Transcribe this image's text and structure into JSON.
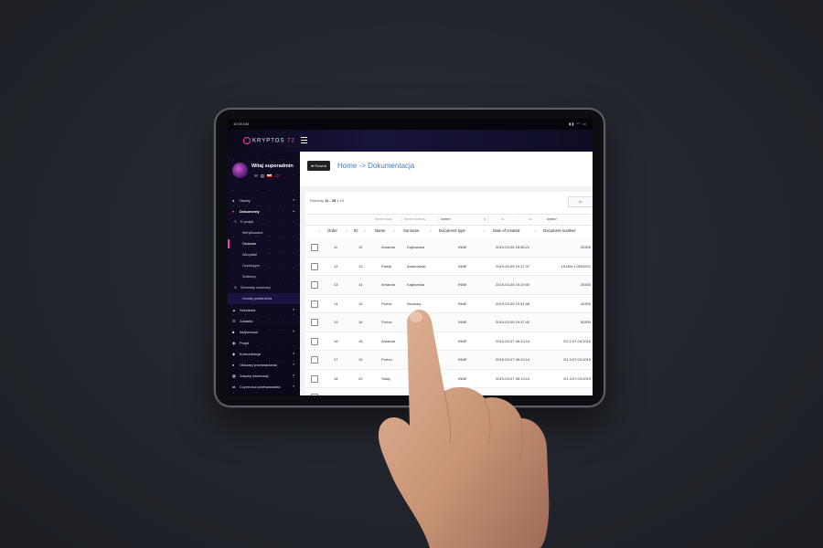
{
  "status_bar": {
    "time": "10:05 AM"
  },
  "app": {
    "logo_text": "KRYPTOS",
    "logo_version": "72"
  },
  "profile": {
    "welcome": "Witaj superadmin"
  },
  "sidebar": {
    "items": [
      {
        "label": "Osoby",
        "icon": "person-icon"
      },
      {
        "label": "Dokumenty",
        "icon": "document-icon",
        "active": true
      },
      {
        "label": "E-podpis",
        "icon": "pen-icon",
        "sub": true
      },
      {
        "label": "Weryfikowane",
        "sub": true
      },
      {
        "label": "Osobowe",
        "sub": true,
        "selected": true
      },
      {
        "label": "Wszystkie",
        "sub": true
      },
      {
        "label": "Oczekujące",
        "sub": true
      },
      {
        "label": "Szablony",
        "sub": true
      },
      {
        "label": "Schematy numeracji",
        "icon": "sort-icon",
        "sub": true
      },
      {
        "label": "Umowy powierzenia",
        "sub": true
      },
      {
        "label": "Szkolenia",
        "icon": "graduation-icon"
      },
      {
        "label": "Zadania",
        "icon": "tasks-icon"
      },
      {
        "label": "Aktywności",
        "icon": "activity-icon"
      },
      {
        "label": "Pulpit",
        "icon": "dashboard-icon"
      },
      {
        "label": "Komunikacja",
        "icon": "chat-icon"
      },
      {
        "label": "Obszary przetwarzania",
        "icon": "pin-icon"
      },
      {
        "label": "Zasoby informacji",
        "icon": "database-icon"
      },
      {
        "label": "Czynności przetwarzania",
        "icon": "exchange-icon"
      }
    ]
  },
  "header": {
    "back_label": "Powrót",
    "breadcrumb": "Home -> Dokumentacja"
  },
  "table": {
    "records_prefix": "Rekordy",
    "records_range": "11 - 19",
    "records_suffix": "z 19",
    "pager_first": "|<",
    "filters": [
      "Wybierz datę",
      "Wybierz dzielnię",
      "wybierz",
      "od",
      "do",
      "wybierz"
    ],
    "columns": [
      "Order",
      "ID",
      "Name",
      "Surname",
      "Document type",
      "Date of created",
      "Document number"
    ],
    "rows": [
      {
        "order": "11",
        "id": "12",
        "name": "Amanda",
        "surname": "Kajkowska",
        "type": "INNE",
        "date": "2019-03-05 18:38:21",
        "number": "20305"
      },
      {
        "order": "12",
        "id": "13",
        "name": "Patryk",
        "surname": "Adamowski",
        "type": "INNE",
        "date": "2019-03-05 19:17:37",
        "number": "1SJAN.1.0503201"
      },
      {
        "order": "13",
        "id": "14",
        "name": "Amanda",
        "surname": "Kajkowska",
        "type": "INNE",
        "date": "2019-03-05 19:19:00",
        "number": "30305"
      },
      {
        "order": "14",
        "id": "15",
        "name": "Proton",
        "surname": "Novacky",
        "type": "INNE",
        "date": "2019-03-05 19:31:08",
        "number": "40305"
      },
      {
        "order": "15",
        "id": "16",
        "name": "Proton",
        "surname": "",
        "type": "INNE",
        "date": "2019-03-05 19:37:40",
        "number": "50305"
      },
      {
        "order": "16",
        "id": "18",
        "name": "Amanda",
        "surname": "",
        "type": "INNE",
        "date": "2019-03-07 08:13:14",
        "number": "D1.2.07.03.2019"
      },
      {
        "order": "17",
        "id": "19",
        "name": "Proton",
        "surname": "",
        "type": "INNE",
        "date": "2019-03-07 08:13:14",
        "number": "D1.3.07.03.2019"
      },
      {
        "order": "18",
        "id": "20",
        "name": "Vitaly",
        "surname": "",
        "type": "INNE",
        "date": "2019-03-07 08:13:14",
        "number": "D1.4.07.03.2019"
      },
      {
        "order": "19",
        "id": "21",
        "name": "Jerzy",
        "surname": "Ku",
        "type": "INNE",
        "date": "2019-03-07 10:26:46",
        "number": "UPO.1.07.03.2019"
      }
    ]
  },
  "colors": {
    "accent": "#ff3aa6",
    "link": "#3c7fd4",
    "sidebar_bg": "#0d0b22"
  }
}
